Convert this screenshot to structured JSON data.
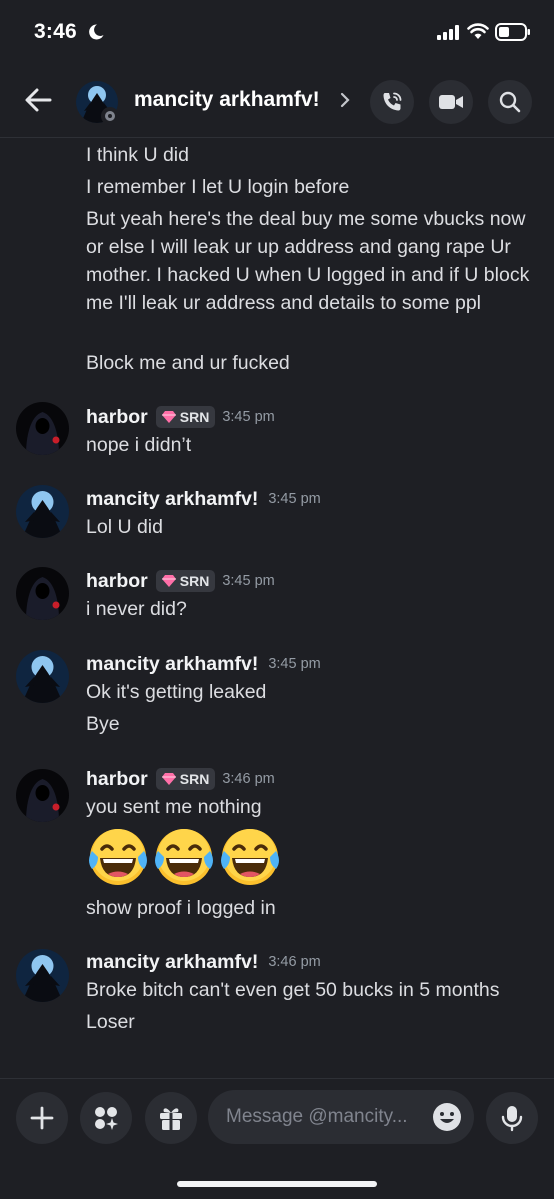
{
  "status_bar": {
    "time": "3:46"
  },
  "header": {
    "name": "mancity arkhamfv!"
  },
  "messages": {
    "g1_lines": [
      "I think U did",
      "I remember I let U login before",
      "But yeah here's the deal buy me some vbucks now or else I will leak ur up address and gang rape Ur mother. I hacked U when U logged in and if U block me I'll leak ur address and details to some ppl",
      "Block me and ur fucked"
    ],
    "g2": {
      "user": "harbor",
      "tag": "SRN",
      "time": "3:45 pm",
      "lines": [
        "nope i didn’t"
      ]
    },
    "g3": {
      "user": "mancity arkhamfv!",
      "time": "3:45 pm",
      "lines": [
        "Lol U did"
      ]
    },
    "g4": {
      "user": "harbor",
      "tag": "SRN",
      "time": "3:45 pm",
      "lines": [
        "i never did?"
      ]
    },
    "g5": {
      "user": "mancity arkhamfv!",
      "time": "3:45 pm",
      "lines": [
        "Ok it's getting leaked",
        "Bye"
      ]
    },
    "g6": {
      "user": "harbor",
      "tag": "SRN",
      "time": "3:46 pm",
      "lines": [
        "you sent me nothing",
        "show proof i logged in"
      ],
      "emojis": [
        "😂",
        "😂",
        "😂"
      ]
    },
    "g7": {
      "user": "mancity arkhamfv!",
      "time": "3:46 pm",
      "lines": [
        "Broke bitch can't even get 50 bucks in 5 months",
        "Loser"
      ]
    }
  },
  "composer": {
    "placeholder": "Message @mancity..."
  },
  "colors": {
    "background": "#1e1f24",
    "button": "#2b2d33",
    "timestamp": "#949ba4",
    "tag_gem": "#ff6fa8"
  }
}
